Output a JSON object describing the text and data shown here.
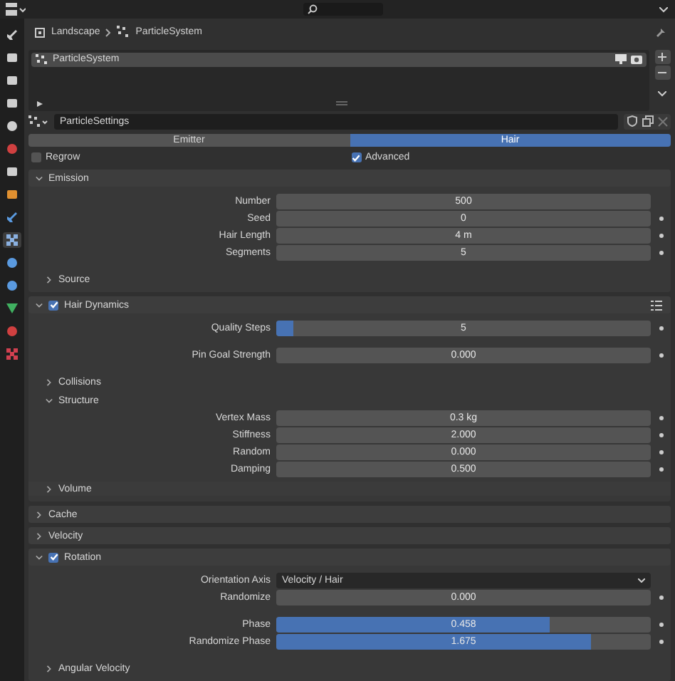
{
  "sidebar_tabs": [
    {
      "kind": "tool",
      "selected": false
    },
    {
      "kind": "render",
      "selected": false
    },
    {
      "kind": "output",
      "selected": false
    },
    {
      "kind": "view",
      "selected": false
    },
    {
      "kind": "scene",
      "selected": false
    },
    {
      "kind": "world",
      "selected": false
    },
    {
      "kind": "collection",
      "selected": false
    },
    {
      "kind": "object",
      "selected": false
    },
    {
      "kind": "modifier",
      "selected": false
    },
    {
      "kind": "particles",
      "selected": true
    },
    {
      "kind": "physics",
      "selected": false
    },
    {
      "kind": "constraints",
      "selected": false
    },
    {
      "kind": "data",
      "selected": false
    },
    {
      "kind": "material",
      "selected": false
    },
    {
      "kind": "texture",
      "selected": false
    }
  ],
  "breadcrumb": [
    "Landscape",
    "ParticleSystem"
  ],
  "particle_systems": [
    {
      "name": "ParticleSystem",
      "selected": true
    }
  ],
  "settings": {
    "name": "ParticleSettings"
  },
  "tabs": [
    {
      "label": "Emitter",
      "selected": false
    },
    {
      "label": "Hair",
      "selected": true
    }
  ],
  "options": [
    {
      "label": "Regrow",
      "checked": false
    },
    {
      "label": "Advanced",
      "checked": true
    }
  ],
  "panels": [
    {
      "title": "Emission",
      "expanded": true,
      "items": [
        {
          "kind": "fields",
          "rows": [
            {
              "kind": "number",
              "label": "Number",
              "value": "500",
              "keyframe": false
            },
            {
              "kind": "number",
              "label": "Seed",
              "value": "0",
              "keyframe": true
            },
            {
              "kind": "number",
              "label": "Hair Length",
              "value": "4 m",
              "keyframe": true
            },
            {
              "kind": "number",
              "label": "Segments",
              "value": "5",
              "keyframe": true
            }
          ]
        },
        {
          "kind": "subpanel",
          "title": "Source",
          "expanded": false
        }
      ]
    },
    {
      "title": "Hair Dynamics",
      "checked": true,
      "expanded": true,
      "items": [
        {
          "kind": "fields",
          "rows": [
            {
              "kind": "slider",
              "label": "Quality Steps",
              "value": "5",
              "level": 0.045,
              "keyframe": true
            }
          ]
        },
        {
          "kind": "fields",
          "rows": [
            {
              "kind": "number",
              "label": "Pin Goal Strength",
              "value": "0.000",
              "keyframe": true
            }
          ]
        },
        {
          "kind": "subpanel",
          "title": "Collisions",
          "expanded": false
        },
        {
          "kind": "subpanel",
          "title": "Structure",
          "expanded": true,
          "items": [
            {
              "kind": "fields",
              "rows": [
                {
                  "kind": "number",
                  "label": "Vertex Mass",
                  "value": "0.3 kg",
                  "keyframe": true
                },
                {
                  "kind": "number",
                  "label": "Stiffness",
                  "value": "2.000",
                  "keyframe": true
                },
                {
                  "kind": "number",
                  "label": "Random",
                  "value": "0.000",
                  "keyframe": true
                },
                {
                  "kind": "number",
                  "label": "Damping",
                  "value": "0.500",
                  "keyframe": true
                }
              ]
            }
          ]
        },
        {
          "kind": "subpanel",
          "title": "Volume",
          "expanded": false
        }
      ]
    },
    {
      "title": "Cache",
      "expanded": false
    },
    {
      "title": "Velocity",
      "expanded": false
    },
    {
      "title": "Rotation",
      "checked": true,
      "expanded": true,
      "items": [
        {
          "kind": "fields",
          "rows": [
            {
              "kind": "dropdown",
              "label": "Orientation Axis",
              "value": "Velocity / Hair",
              "keyframe": false
            },
            {
              "kind": "number",
              "label": "Randomize",
              "value": "0.000",
              "keyframe": true
            }
          ]
        },
        {
          "kind": "fields",
          "rows": [
            {
              "kind": "slider",
              "label": "Phase",
              "value": "0.458",
              "level": 0.73,
              "keyframe": true
            },
            {
              "kind": "slider",
              "label": "Randomize Phase",
              "value": "1.675",
              "level": 0.84,
              "keyframe": true
            }
          ]
        },
        {
          "kind": "subpanel",
          "title": "Angular Velocity",
          "expanded": false
        }
      ]
    }
  ]
}
